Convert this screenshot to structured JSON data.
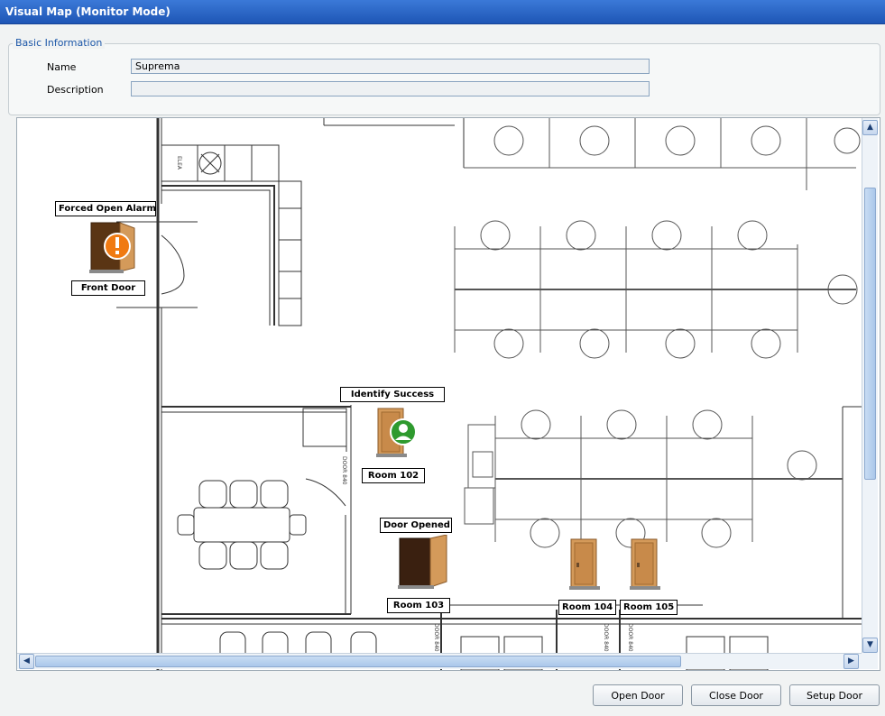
{
  "window": {
    "title": "Visual Map (Monitor Mode)"
  },
  "basic_info": {
    "legend": "Basic Information",
    "name_label": "Name",
    "name_value": "Suprema",
    "description_label": "Description",
    "description_value": ""
  },
  "map": {
    "doors": [
      {
        "label": "Front Door",
        "status": "Forced Open Alarm",
        "state_icon": "alarm-icon"
      },
      {
        "label": "Room 102",
        "status": "Identify Success",
        "state_icon": "user-ok-icon"
      },
      {
        "label": "Room 103",
        "status": "Door Opened",
        "state_icon": "door-open-icon"
      },
      {
        "label": "Room 104",
        "status": "",
        "state_icon": "door-closed-icon"
      },
      {
        "label": "Room 105",
        "status": "",
        "state_icon": "door-closed-icon"
      }
    ],
    "floor_plan_text": {
      "door_tag": "DOOR 840",
      "tag_small": "ELEA"
    }
  },
  "buttons": {
    "open_door": "Open Door",
    "close_door": "Close Door",
    "setup_door": "Setup Door"
  },
  "colors": {
    "title_bar": "#2a64c6",
    "legend_text": "#1c57a8",
    "alarm": "#f07a12",
    "success": "#2e9a2e",
    "door_wood": "#d49a5a"
  }
}
